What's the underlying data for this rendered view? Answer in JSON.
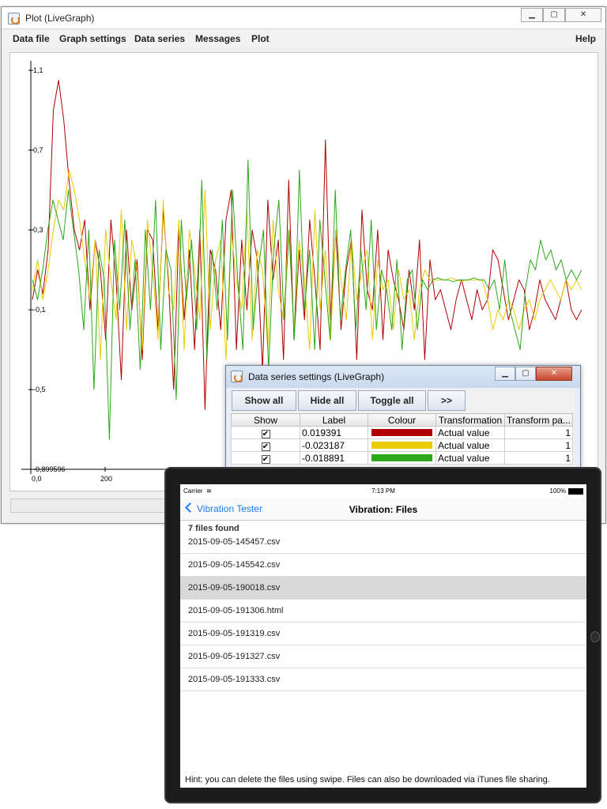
{
  "main_window": {
    "title": "Plot (LiveGraph)",
    "buttons": {
      "minimize": "▁",
      "maximize": "▢",
      "close": "✕"
    },
    "menu": [
      "Data file",
      "Graph settings",
      "Data series",
      "Messages",
      "Plot"
    ],
    "help": "Help"
  },
  "chart_data": {
    "type": "line",
    "y_ticks": [
      "1,1",
      "0,7",
      "0,3",
      "-0,1",
      "-0,5",
      "-0,899596"
    ],
    "x_ticks": [
      "0,0",
      "200"
    ],
    "ylim": [
      -0.899596,
      1.1
    ],
    "grid": false,
    "series": [
      {
        "color": "#b00000",
        "values": [
          -0.05,
          0.1,
          -0.02,
          0.2,
          0.9,
          1.05,
          0.85,
          0.55,
          0.3,
          0.2,
          0.35,
          -0.1,
          0.25,
          0.1,
          -0.25,
          0.35,
          0.05,
          -0.45,
          0.3,
          -0.1,
          0.15,
          -0.35,
          0.3,
          0.25,
          -0.2,
          0.4,
          0.05,
          -0.5,
          0.3,
          -0.15,
          0.2,
          -0.3,
          0.3,
          -0.6,
          0.2,
          0.1,
          -0.2,
          0.35,
          0.5,
          -0.3,
          0.25,
          -0.1,
          0.3,
          0.15,
          -0.4,
          0.45,
          0.05,
          0.25,
          -0.35,
          0.55,
          -0.25,
          0.2,
          -0.15,
          0.35,
          0.05,
          -0.3,
          0.75,
          -0.15,
          0.3,
          -0.2,
          0.1,
          0.25,
          -0.35,
          0.4,
          0.0,
          -0.1,
          0.3,
          -0.25,
          0.2,
          0.05,
          -0.05,
          -0.2,
          0.1,
          -0.1,
          0.25,
          -0.35,
          0.15,
          -0.05,
          0.0,
          -0.1,
          -0.2,
          -0.05,
          0.05,
          -0.05,
          -0.15,
          0.0,
          -0.1,
          -0.05,
          0.2,
          0.15,
          0.0,
          -0.15,
          -0.05,
          0.05,
          0.0,
          -0.2,
          -0.1,
          0.05,
          -0.05,
          -0.1,
          -0.15,
          -0.05,
          0.05,
          -0.1,
          -0.15,
          -0.1
        ]
      },
      {
        "color": "#e8cc00",
        "values": [
          0.0,
          0.15,
          -0.05,
          0.1,
          0.3,
          0.45,
          0.4,
          0.6,
          0.5,
          0.35,
          0.15,
          -0.05,
          0.25,
          -0.35,
          0.3,
          0.05,
          -0.15,
          0.4,
          -0.2,
          0.25,
          0.1,
          -0.3,
          0.35,
          0.1,
          -0.25,
          0.45,
          0.0,
          -0.1,
          0.35,
          -0.3,
          0.3,
          0.1,
          -0.15,
          0.5,
          -0.2,
          0.15,
          0.25,
          -0.35,
          0.3,
          0.05,
          -0.1,
          0.4,
          -0.25,
          0.2,
          0.1,
          -0.3,
          0.35,
          0.0,
          -0.15,
          0.3,
          -0.2,
          0.25,
          0.05,
          -0.3,
          0.4,
          -0.1,
          0.2,
          -0.25,
          0.3,
          0.05,
          -0.15,
          0.25,
          -0.05,
          0.1,
          0.2,
          -0.25,
          0.15,
          0.0,
          0.05,
          -0.2,
          0.1,
          -0.05,
          0.0,
          -0.25,
          0.0,
          0.1,
          0.05,
          0.05,
          0.05,
          0.05,
          0.06,
          0.05,
          0.04,
          0.05,
          0.05,
          0.05,
          0.05,
          -0.05,
          -0.2,
          -0.1,
          -0.15,
          -0.05,
          -0.1,
          -0.2,
          -0.1,
          -0.05,
          -0.15,
          -0.05,
          0.0,
          0.05,
          0.0,
          -0.05,
          0.05,
          0.0,
          0.05,
          0.0
        ]
      },
      {
        "color": "#2aa81a",
        "values": [
          0.05,
          -0.05,
          0.1,
          0.3,
          0.45,
          0.35,
          0.25,
          0.5,
          0.3,
          0.1,
          -0.2,
          0.3,
          -0.5,
          0.2,
          0.05,
          -0.75,
          0.25,
          -0.1,
          0.35,
          -0.2,
          0.15,
          -0.4,
          0.3,
          -0.1,
          0.45,
          -0.3,
          0.2,
          0.1,
          -0.55,
          0.35,
          -0.05,
          0.25,
          -0.2,
          0.55,
          -0.35,
          0.2,
          -0.1,
          0.35,
          -0.25,
          0.5,
          0.05,
          -0.3,
          0.65,
          -0.2,
          0.1,
          0.3,
          -0.4,
          0.2,
          0.45,
          -0.15,
          0.3,
          -0.25,
          0.6,
          -0.1,
          0.2,
          -0.3,
          0.35,
          0.05,
          -0.25,
          0.5,
          -0.15,
          0.1,
          0.3,
          -0.2,
          0.2,
          -0.1,
          0.35,
          -0.2,
          0.1,
          0.0,
          -0.2,
          0.15,
          -0.3,
          0.05,
          0.1,
          -0.2,
          0.05,
          0.0,
          0.05,
          0.06,
          0.05,
          0.05,
          0.04,
          0.05,
          0.05,
          0.05,
          0.06,
          0.05,
          0.05,
          0.0,
          0.05,
          -0.1,
          0.15,
          -0.1,
          -0.2,
          -0.3,
          0.0,
          0.15,
          0.1,
          0.25,
          0.15,
          0.2,
          0.1,
          0.15,
          0.05,
          0.1,
          0.05,
          0.1
        ]
      }
    ]
  },
  "ds_window": {
    "title": "Data series settings (LiveGraph)",
    "buttons": {
      "minimize": "▁",
      "maximize": "▢",
      "close": "✕"
    },
    "toolbar": [
      "Show all",
      "Hide all",
      "Toggle all",
      ">>"
    ],
    "headers": [
      "Show",
      "Label",
      "Colour",
      "Transformation",
      "Transform pa..."
    ],
    "rows": [
      {
        "show": "✔",
        "label": "0.019391",
        "colour": "#b00000",
        "transformation": "Actual value",
        "param": "1"
      },
      {
        "show": "✔",
        "label": "-0.023187",
        "colour": "#e8cc00",
        "transformation": "Actual value",
        "param": "1"
      },
      {
        "show": "✔",
        "label": "-0.018891",
        "colour": "#2aa81a",
        "transformation": "Actual value",
        "param": "1"
      }
    ]
  },
  "ipad": {
    "status": {
      "carrier": "Carrier",
      "time": "7:13 PM",
      "battery": "100%"
    },
    "nav": {
      "back": "Vibration Tester",
      "title": "Vibration: Files"
    },
    "section_header": "7 files found",
    "files": [
      "2015-09-05-145457.csv",
      "2015-09-05-145542.csv",
      "2015-09-05-190018.csv",
      "2015-09-05-191306.html",
      "2015-09-05-191319.csv",
      "2015-09-05-191327.csv",
      "2015-09-05-191333.csv"
    ],
    "selected_index": 2,
    "hint": "Hint: you can delete the files using swipe. Files can also be downloaded via iTunes file sharing."
  }
}
